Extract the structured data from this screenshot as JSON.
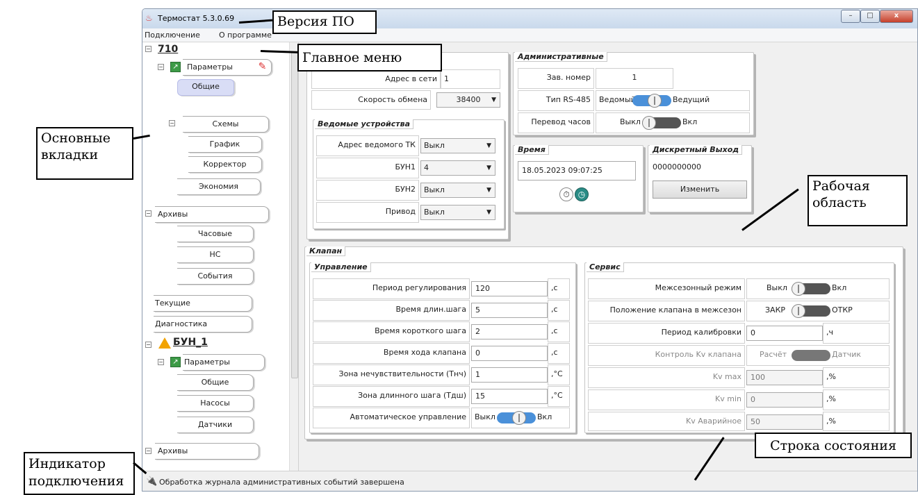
{
  "window": {
    "title": "Термостат 5.3.0.69",
    "minimize": "–",
    "maximize": "□",
    "close": "x"
  },
  "menu": {
    "connect": "Подключение",
    "about": "О программе"
  },
  "tree": {
    "device1": "710",
    "params": "Параметры",
    "general": "Общие",
    "schemes": "Схемы",
    "graph": "График",
    "corrector": "Корректор",
    "economy": "Экономия",
    "archives": "Архивы",
    "hourly": "Часовые",
    "ns": "НС",
    "events": "События",
    "current": "Текущие",
    "diagnostics": "Диагностика",
    "device2": "БУН_1",
    "params2": "Параметры",
    "general2": "Общие",
    "pumps": "Насосы",
    "sensors": "Датчики",
    "archives2": "Архивы"
  },
  "top_group": {
    "addr_label": "Адрес в сети",
    "addr_value": "1",
    "speed_label": "Скорость обмена",
    "speed_value": "38400"
  },
  "slaves": {
    "title": "Ведомые устройства",
    "rows": [
      {
        "label": "Адрес ведомого ТК",
        "value": "Выкл"
      },
      {
        "label": "БУН1",
        "value": "4"
      },
      {
        "label": "БУН2",
        "value": "Выкл"
      },
      {
        "label": "Привод",
        "value": "Выкл"
      }
    ]
  },
  "admin": {
    "title": "Административные",
    "serial_label": "Зав. номер",
    "serial_value": "1",
    "rs485_label": "Тип RS-485",
    "rs485_off": "Ведомый",
    "rs485_on": "Ведущий",
    "clock_label": "Перевод часов",
    "clock_off": "Выкл",
    "clock_on": "Вкл"
  },
  "time": {
    "title": "Время",
    "value": "18.05.2023 09:07:25"
  },
  "dout": {
    "title": "Дискретный Выход",
    "value": "0000000000",
    "button": "Изменить"
  },
  "valve": {
    "title": "Клапан",
    "control_title": "Управление",
    "control_rows": [
      {
        "label": "Период регулирования",
        "value": "120",
        "unit": ",с"
      },
      {
        "label": "Время длин.шага",
        "value": "5",
        "unit": ",с"
      },
      {
        "label": "Время короткого шага",
        "value": "2",
        "unit": ",с"
      },
      {
        "label": "Время хода клапана",
        "value": "0",
        "unit": ",с"
      },
      {
        "label": "Зона нечувствительности (Тнч)",
        "value": "1",
        "unit": ",°С"
      },
      {
        "label": "Зона длинного шага (Тдш)",
        "value": "15",
        "unit": ",°С"
      }
    ],
    "auto_label": "Автоматическое управление",
    "auto_off": "Выкл",
    "auto_on": "Вкл",
    "service_title": "Сервис",
    "interseason_label": "Межсезонный режим",
    "interseason_off": "Выкл",
    "interseason_on": "Вкл",
    "position_label": "Положение клапана в межсезон",
    "position_off": "ЗАКР",
    "position_on": "ОТКР",
    "calib_label": "Период калибровки",
    "calib_value": "0",
    "calib_unit": ",ч",
    "kv_ctrl_label": "Контроль Kv клапана",
    "kv_ctrl_off": "Расчёт",
    "kv_ctrl_on": "Датчик",
    "kvmax_label": "Kv max",
    "kvmax_value": "100",
    "kvmin_label": "Kv min",
    "kvmin_value": "0",
    "kvalarm_label": "Kv Аварийное",
    "kvalarm_value": "50",
    "pct": ",%"
  },
  "status": {
    "text": "Обработка журнала административных событий завершена"
  },
  "annotations": {
    "version": "Версия ПО",
    "main_menu": "Главное меню",
    "main_tabs_1": "Основные",
    "main_tabs_2": "вкладки",
    "work_area_1": "Рабочая",
    "work_area_2": "область",
    "status_bar": "Строка состояния",
    "conn_ind_1": "Индикатор",
    "conn_ind_2": "подключения"
  },
  "colors": {
    "toggle_on": "#4a90d9",
    "toggle_off": "#555555"
  }
}
